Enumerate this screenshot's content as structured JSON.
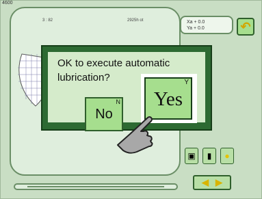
{
  "screen": {
    "code": "4600"
  },
  "header": {
    "left_value": "3 : 82",
    "right_value": "2925h ot"
  },
  "coords": {
    "xa": "Xa + 0.0",
    "ya": "Ya + 0.0"
  },
  "dialog": {
    "message": "OK to execute automatic lubrication?",
    "no_label": "No",
    "no_key": "N",
    "yes_label": "Yes",
    "yes_key": "Y"
  },
  "icons": {
    "undo": "undo-icon",
    "hand": "pointing-hand-icon",
    "monitor": "monitor-icon",
    "thread": "thread-icon",
    "light": "light-bulb-icon",
    "arrows": "left-right-arrows-icon"
  },
  "colors": {
    "background": "#c9dec4",
    "dialog_frame": "#2d6a32",
    "dialog_body": "#d5ebcb",
    "button": "#a6de8e"
  }
}
